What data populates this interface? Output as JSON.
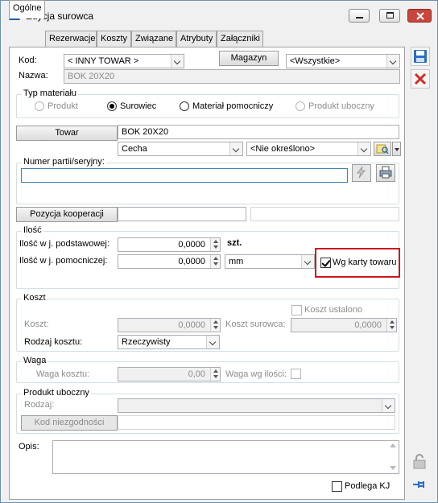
{
  "window": {
    "title": "Edycja surowca"
  },
  "tabs": [
    "Ogólne",
    "Rezerwacje",
    "Koszty",
    "Związane",
    "Atrybuty",
    "Załączniki"
  ],
  "header": {
    "kod_label": "Kod:",
    "kod_value": "< INNY TOWAR >",
    "magazyn_button": "Magazyn",
    "magazyn_value": "<Wszystkie>",
    "nazwa_label": "Nazwa:",
    "nazwa_value": "BOK 20X20"
  },
  "typ_materialu": {
    "title": "Typ materiału",
    "options": [
      {
        "label": "Produkt",
        "selected": false,
        "enabled": false
      },
      {
        "label": "Surowiec",
        "selected": true,
        "enabled": true
      },
      {
        "label": "Materiał pomocniczy",
        "selected": false,
        "enabled": true
      },
      {
        "label": "Produkt uboczny",
        "selected": false,
        "enabled": false
      }
    ]
  },
  "towar": {
    "button": "Towar",
    "value": "BOK 20X20",
    "cecha_value": "Cecha",
    "cecha_select": "<Nie określono>"
  },
  "partia": {
    "label": "Numer partii/seryjny:",
    "value": ""
  },
  "kooperacja": {
    "button": "Pozycja kooperacji",
    "value": "",
    "value2": ""
  },
  "ilosc": {
    "title": "Ilość",
    "podstawowa_label": "Ilość w j. podstawowej:",
    "podstawowa_value": "0,0000",
    "podstawowa_unit": "szt.",
    "pomocnicza_label": "Ilość w j. pomocniczej:",
    "pomocnicza_value": "0,0000",
    "pomocnicza_unit": "mm",
    "wg_karty_label": "Wg karty towaru",
    "wg_karty_checked": true
  },
  "koszt": {
    "title": "Koszt",
    "ustalony_label": "Koszt ustalono",
    "koszt_label": "Koszt:",
    "koszt_value": "0,0000",
    "koszt_surowca_label": "Koszt surowca:",
    "koszt_surowca_value": "0,0000",
    "rodzaj_label": "Rodzaj kosztu:",
    "rodzaj_value": "Rzeczywisty"
  },
  "waga": {
    "title": "Waga",
    "waga_kosztu_label": "Waga kosztu:",
    "waga_kosztu_value": "0,00",
    "waga_ilosci_label": "Waga wg ilości:"
  },
  "produkt_uboczny": {
    "title": "Produkt uboczny",
    "rodzaj_label": "Rodzaj:",
    "rodzaj_value": "",
    "kod_button": "Kod niezgodności",
    "kod_value": ""
  },
  "opis": {
    "label": "Opis:",
    "value": ""
  },
  "podlega_kj": {
    "label": "Podlega KJ",
    "checked": false
  },
  "colors": {
    "accent": "#1e73be",
    "highlight": "#d0121b",
    "close": "#c9463d"
  }
}
